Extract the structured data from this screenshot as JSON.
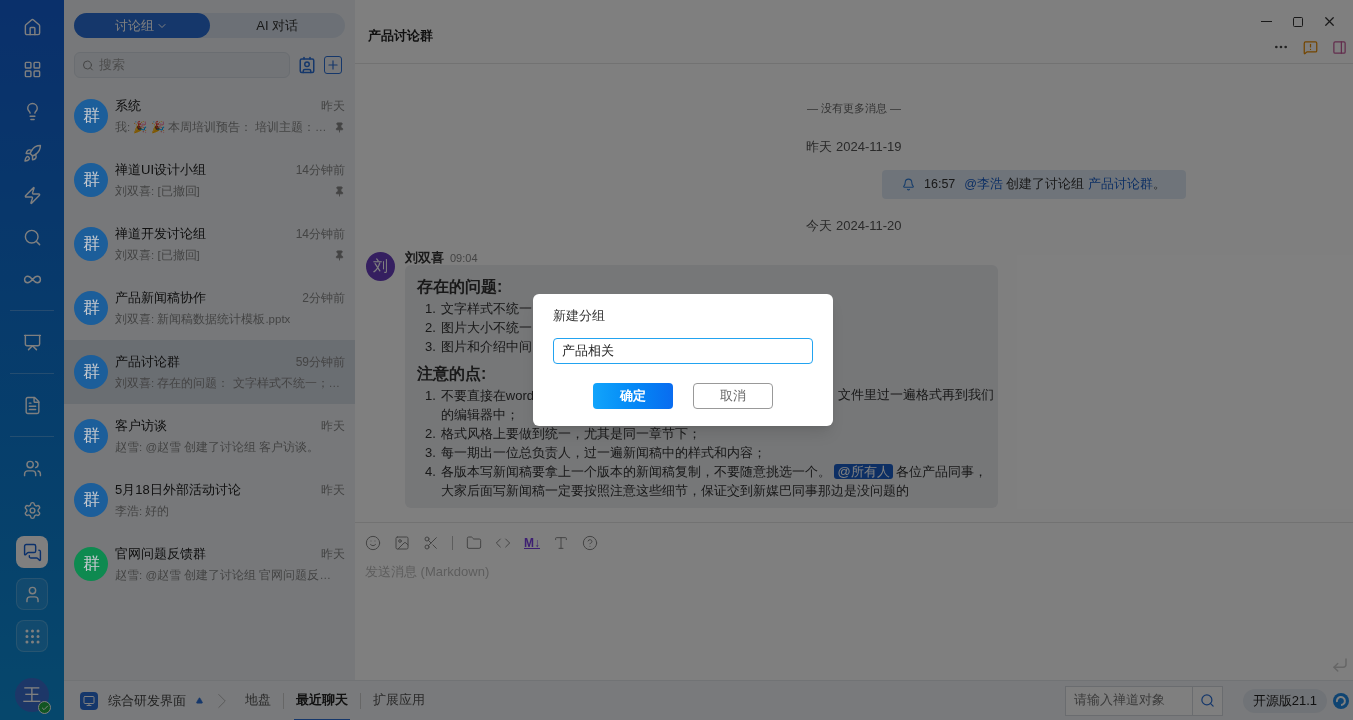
{
  "rail": {
    "groups": [
      [
        {
          "kind": "plain",
          "selected": false
        },
        {
          "kind": "plain",
          "selected": false
        },
        {
          "kind": "plain",
          "selected": false
        },
        {
          "kind": "plain",
          "selected": false
        },
        {
          "kind": "plain",
          "selected": false
        },
        {
          "kind": "plain",
          "selected": false
        },
        {
          "kind": "plain",
          "selected": false
        }
      ],
      [
        {
          "kind": "plain",
          "selected": false
        }
      ],
      [
        {
          "kind": "plain",
          "selected": false
        }
      ],
      [
        {
          "kind": "plain",
          "selected": false
        },
        {
          "kind": "plain",
          "selected": false
        },
        {
          "kind": "boxed",
          "selected": true
        },
        {
          "kind": "boxed",
          "selected": false
        },
        {
          "kind": "boxed",
          "selected": false
        }
      ]
    ],
    "user_avatar": {
      "initial": "王",
      "online": true
    }
  },
  "chat_list": {
    "tabs": [
      {
        "label": "讨论组",
        "selected": true,
        "dropdown": true
      },
      {
        "label": "AI 对话",
        "selected": false,
        "dropdown": false
      }
    ],
    "search": {
      "placeholder": "搜索"
    },
    "items": [
      {
        "avatar": "群",
        "color": "#1c5e9a",
        "name": "系统",
        "time": "昨天",
        "preview": "我: 🎉 🎉 本周培训预告： 培训主题：…",
        "pinned": true,
        "selected": false
      },
      {
        "avatar": "群",
        "color": "#1c5e9a",
        "name": "禅道UI设计小组",
        "time": "14分钟前",
        "preview": "刘双喜: [已撤回]",
        "pinned": true,
        "selected": false
      },
      {
        "avatar": "群",
        "color": "#1c5e9a",
        "name": "禅道开发讨论组",
        "time": "14分钟前",
        "preview": "刘双喜: [已撤回]",
        "pinned": true,
        "selected": false
      },
      {
        "avatar": "群",
        "color": "#1c5e9a",
        "name": "产品新闻稿协作",
        "time": "2分钟前",
        "preview": "刘双喜: 新闻稿数据统计模板.pptx",
        "pinned": false,
        "selected": false
      },
      {
        "avatar": "群",
        "color": "#1c5e9a",
        "name": "产品讨论群",
        "time": "59分钟前",
        "preview": "刘双喜: 存在的问题： 文字样式不统一；…",
        "pinned": false,
        "selected": true
      },
      {
        "avatar": "群",
        "color": "#1c5e9a",
        "name": "客户访谈",
        "time": "昨天",
        "preview": "赵雪: @赵雪 创建了讨论组 客户访谈。",
        "pinned": false,
        "selected": false
      },
      {
        "avatar": "群",
        "color": "#1c5e9a",
        "name": "5月18日外部活动讨论",
        "time": "昨天",
        "preview": "李浩: 好的",
        "pinned": false,
        "selected": false
      },
      {
        "avatar": "群",
        "color": "#0e8a50",
        "name": "官网问题反馈群",
        "time": "昨天",
        "preview": "赵雪: @赵雪 创建了讨论组 官网问题反…",
        "pinned": false,
        "selected": false
      }
    ]
  },
  "chat": {
    "title": "产品讨论群",
    "no_more": "— 没有更多消息 —",
    "day1": "昨天 2024-11-19",
    "notice": {
      "time": "16:57",
      "mention": "@李浩",
      "text": "创建了讨论组",
      "group": "产品讨论群",
      "end": "。"
    },
    "day2": "今天 2024-11-20",
    "message": {
      "avatar": "刘",
      "sender": "刘双喜",
      "time": "09:04",
      "heading1": "存在的问题:",
      "problems": [
        {
          "number": "1.",
          "text": "文字样式不统一"
        },
        {
          "number": "2.",
          "text": "图片大小不统一"
        },
        {
          "number": "3.",
          "text": "图片和介绍中间"
        }
      ],
      "heading2": "注意的点:",
      "notes": [
        {
          "number": "1.",
          "text": "不要直接在word",
          "text_right": "文件里过一遍格式再到我们",
          "continuation": "的编辑器中；"
        },
        {
          "number": "2.",
          "text": "格式风格上要做到统一，尤其是同一章节下；"
        },
        {
          "number": "3.",
          "text": "每一期出一位总负责人，过一遍新闻稿中的样式和内容；"
        },
        {
          "number": "4.",
          "text": "各版本写新闻稿要拿上一个版本的新闻稿复制，不要随意挑选一个。",
          "mention": "@所有人",
          "after": "各位产品同事，大家后面写新闻稿一定要按照注意这些细节，保证交到新媒巴同事那边是没问题的"
        }
      ]
    },
    "toolbar": [
      {
        "kind": "icon"
      },
      {
        "kind": "icon"
      },
      {
        "kind": "icon"
      },
      {
        "kind": "icon"
      },
      {
        "kind": "icon"
      },
      {
        "kind": "text",
        "label": "M↓"
      },
      {
        "kind": "icon"
      },
      {
        "kind": "icon"
      }
    ],
    "input_placeholder": "发送消息 (Markdown)"
  },
  "bottom_bar": {
    "workspace": "综合研发界面",
    "tabs": [
      {
        "label": "地盘",
        "selected": false
      },
      {
        "label": "最近聊天",
        "selected": true
      },
      {
        "label": "扩展应用",
        "selected": false
      }
    ],
    "search_placeholder": "请输入禅道对象",
    "version": "开源版21.1"
  },
  "dialog": {
    "title": "新建分组",
    "value": "产品相关",
    "buttons": [
      {
        "label": "确定",
        "kind": "primary"
      },
      {
        "label": "取消",
        "kind": "secondary"
      }
    ]
  }
}
